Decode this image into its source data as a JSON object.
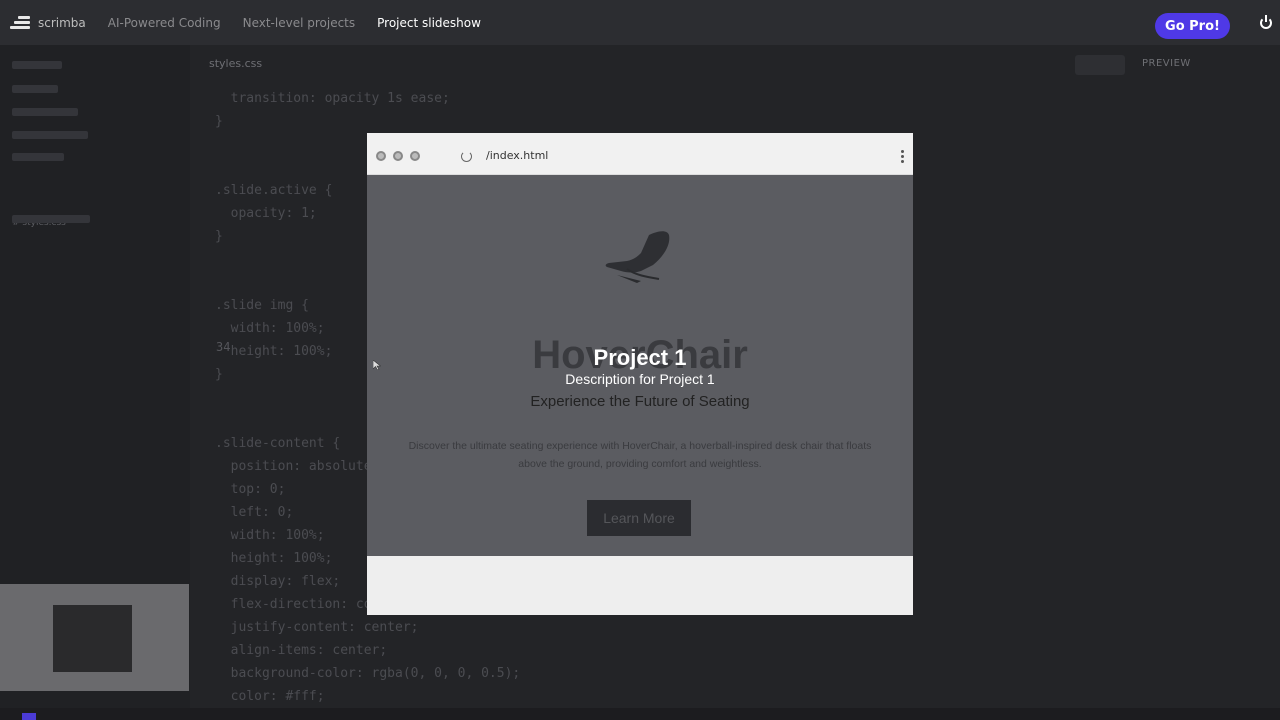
{
  "app": {
    "name": "scrimba"
  },
  "breadcrumbs": [
    "AI-Powered Coding",
    "Next-level projects",
    "Project slideshow"
  ],
  "topbar": {
    "cta_label": "Go Pro!",
    "cta_color": "#4f39e6"
  },
  "editor": {
    "file_tab": "styles.css",
    "preview_label": "PREVIEW",
    "sidebar_file": "# styles.css",
    "line_number": "34",
    "code_lines": [
      "  transition: opacity 1s ease;",
      "}",
      "",
      "",
      ".slide.active {",
      "  opacity: 1;",
      "}",
      "",
      "",
      ".slide img {",
      "  width: 100%;",
      "  height: 100%;",
      "}",
      "",
      "",
      ".slide-content {",
      "  position: absolute;",
      "  top: 0;",
      "  left: 0;",
      "  width: 100%;",
      "  height: 100%;",
      "  display: flex;",
      "  flex-direction: column;",
      "  justify-content: center;",
      "  align-items: center;",
      "  background-color: rgba(0, 0, 0, 0.5);",
      "  color: #fff;"
    ]
  },
  "preview": {
    "url": "/index.html",
    "hero_title": "HoverChair",
    "slide_title": "Project 1",
    "slide_description": "Description for Project 1",
    "tagline": "Experience the Future of Seating",
    "body": "Discover the ultimate seating experience with HoverChair, a hoverball-inspired desk chair that floats above the ground, providing comfort and weightless.",
    "button_label": "Learn More",
    "overlay_color": "#5b5c61"
  }
}
